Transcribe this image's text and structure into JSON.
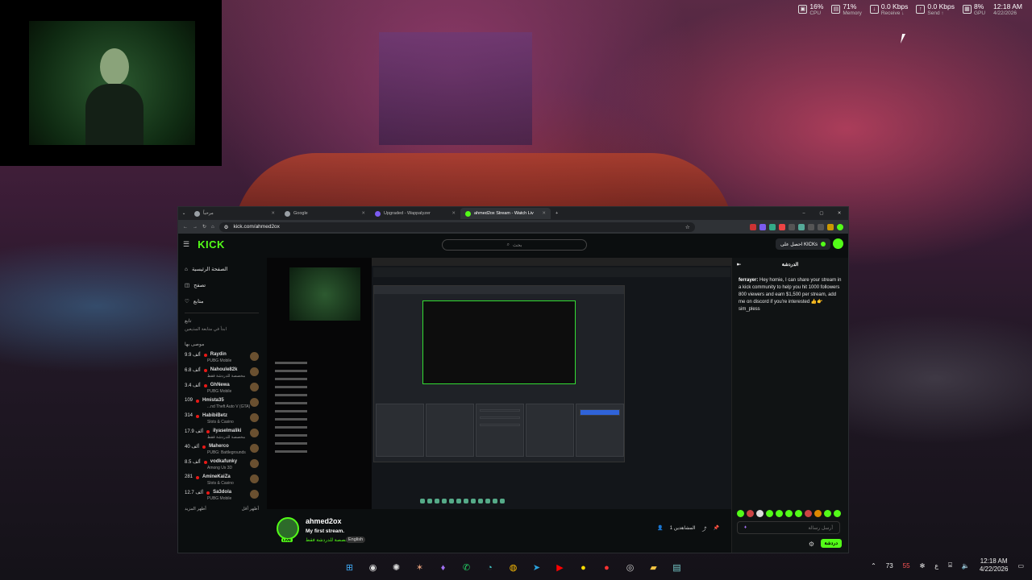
{
  "sysmon": [
    {
      "icon": "cpu-icon",
      "value": "16%",
      "label": "CPU"
    },
    {
      "icon": "memory-icon",
      "value": "71%",
      "label": "Memory"
    },
    {
      "icon": "network-receive-icon",
      "value": "0.0 Kbps",
      "label": "Receive ↓"
    },
    {
      "icon": "network-send-icon",
      "value": "0.0 Kbps",
      "label": "Send ↑"
    },
    {
      "icon": "gpu-icon",
      "value": "8%",
      "label": "GPU"
    }
  ],
  "sysmon_clock": {
    "time": "12:18 AM",
    "date": "4/22/2026"
  },
  "browser": {
    "tabs": [
      {
        "label": "مرحباً",
        "active": false
      },
      {
        "label": "Google",
        "active": false
      },
      {
        "label": "Upgraded - Wappalyzer",
        "active": false
      },
      {
        "label": "ahmed2ox Stream - Watch Liv",
        "active": true
      }
    ],
    "url": "kick.com/ahmed2ox"
  },
  "kick": {
    "logo": "KICK",
    "search_placeholder": "بحث",
    "get_kicks": "احصل على KICKs",
    "nav": [
      {
        "label": "الصفحة الرئيسية",
        "icon": "home-icon"
      },
      {
        "label": "تصفح",
        "icon": "browse-icon"
      },
      {
        "label": "متابع",
        "icon": "heart-icon"
      }
    ],
    "following_title": "تابع",
    "following_empty": "ابدأ في متابعة المذيعين",
    "recommended_title": "موصى بها",
    "channels": [
      {
        "name": "Raydin",
        "game": "PUBG Mobile",
        "count": "9.9 ألف"
      },
      {
        "name": "Nahoule82k",
        "game": "مخصصة للدردشة فقط",
        "count": "6.8 ألف"
      },
      {
        "name": "GhNewa",
        "game": "PUBG Mobile",
        "count": "3.4 ألف"
      },
      {
        "name": "Hmista35",
        "game": "...nd Theft Auto V (GTA)",
        "count": "109"
      },
      {
        "name": "HabibiBetz",
        "game": "Slots & Casino",
        "count": "314"
      },
      {
        "name": "ilyaselmaliki",
        "game": "مخصصة للدردشة فقط",
        "count": "17.9 ألف"
      },
      {
        "name": "Maherco",
        "game": "PUBG: Battlegrounds",
        "count": "40 ألف"
      },
      {
        "name": "vodkafunky",
        "game": "Among Us 3D",
        "count": "8.5 ألف"
      },
      {
        "name": "AmineKaiZa",
        "game": "Slots & Casino",
        "count": "281"
      },
      {
        "name": "Sa3dola",
        "game": "PUBG Mobile",
        "count": "12.7 ألف"
      }
    ],
    "show_more": "أظهر المزيد",
    "show_less": "أظهر أقل",
    "streamer": {
      "name": "ahmed2ox",
      "title": "My first stream.",
      "category": "مخصصة للدردشة فقط",
      "language": "English",
      "live": "LIVE",
      "viewers": "1 المشاهدين"
    },
    "chat": {
      "title": "الدردشة",
      "user": "ferrayer:",
      "message": "Hey homie, I can share your stream in a kick community to help you hit 1000 followers 800 viewers and earn $1,500 per stream, add me on discord if you're interested 👍👉 sim_pless",
      "placeholder": "أرسل رسالة",
      "send": "دردشة"
    }
  },
  "taskbar": {
    "apps": [
      "windows-start-icon",
      "obs-icon",
      "chatgpt-icon",
      "claude-icon",
      "feather-icon",
      "whatsapp-icon",
      "copilot-icon",
      "chrome-icon",
      "telegram-icon",
      "youtube-icon",
      "notification-icon",
      "record-icon",
      "browser-icon",
      "folder-icon",
      "notepad-icon"
    ],
    "temp": "73",
    "temp2": "55",
    "lang": "ع",
    "time": "12:18 AM",
    "date": "4/22/2026"
  }
}
